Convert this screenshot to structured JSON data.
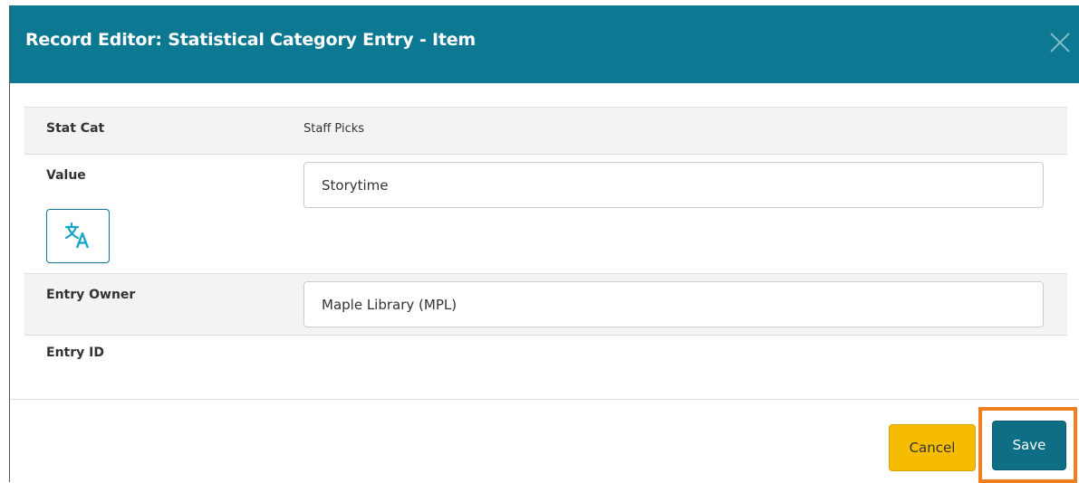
{
  "dialog": {
    "title": "Record Editor: Statistical Category Entry - Item",
    "close_icon": "close-icon",
    "header_color": "#0d7891"
  },
  "fields": {
    "stat_cat": {
      "label": "Stat Cat",
      "value": "Staff Picks"
    },
    "value": {
      "label": "Value",
      "input_value": "Storytime",
      "translate_icon": "translate-icon"
    },
    "entry_owner": {
      "label": "Entry Owner",
      "input_value": "Maple Library (MPL)"
    },
    "entry_id": {
      "label": "Entry ID",
      "value": ""
    }
  },
  "footer": {
    "cancel_label": "Cancel",
    "save_label": "Save",
    "cancel_color": "#f5bc00",
    "save_color": "#0d6e85",
    "highlight_color": "#f0801f"
  }
}
